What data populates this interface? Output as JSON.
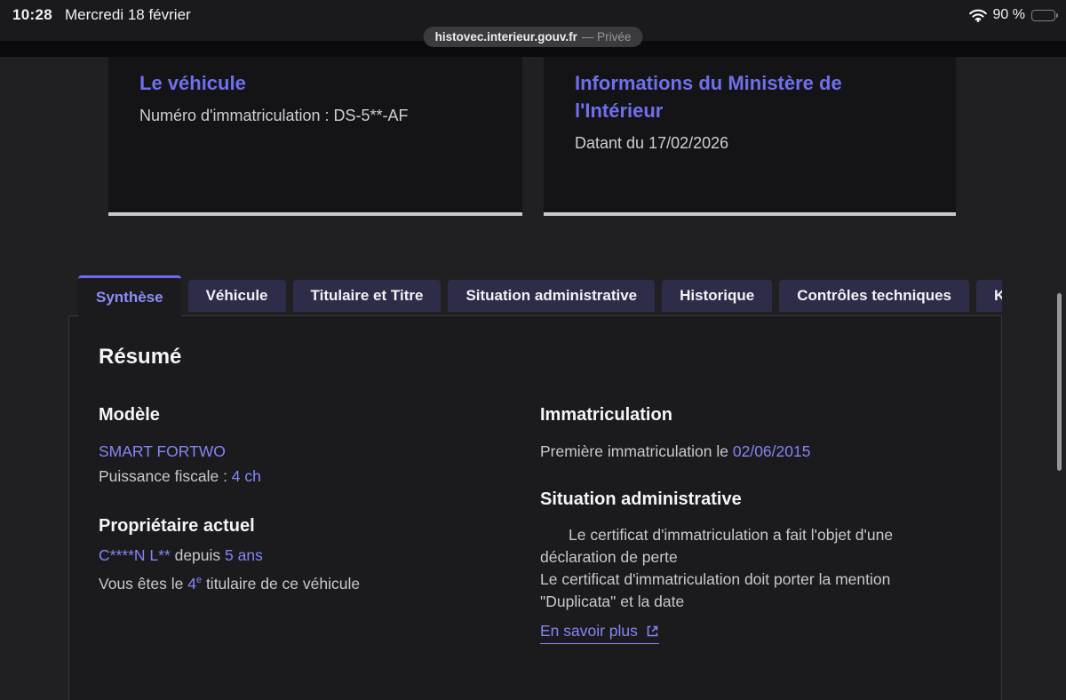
{
  "theme": {
    "accent_title": "#6f6ff0",
    "accent_text": "#8585f6",
    "tab_inactive_bg": "#2d2d49",
    "panel_bg": "#1b1b1d",
    "card_bg": "#141416"
  },
  "status_bar": {
    "time": "10:28",
    "date": "Mercredi 18 février",
    "battery": "90 %",
    "icons": {
      "wifi": "wifi-icon",
      "battery": "battery-icon"
    }
  },
  "browser": {
    "url": "histovec.interieur.gouv.fr",
    "privacy": "— Privée"
  },
  "cards": [
    {
      "title": "Le véhicule",
      "body": "Numéro d'immatriculation : DS-5**-AF"
    },
    {
      "title": "Informations du Ministère de l'Intérieur",
      "body": "Datant du 17/02/2026"
    }
  ],
  "tabs": [
    {
      "label": "Synthèse",
      "active": true
    },
    {
      "label": "Véhicule",
      "active": false
    },
    {
      "label": "Titulaire et Titre",
      "active": false
    },
    {
      "label": "Situation administrative",
      "active": false
    },
    {
      "label": "Historique",
      "active": false
    },
    {
      "label": "Contrôles techniques",
      "active": false
    },
    {
      "label": "Kil",
      "active": false
    }
  ],
  "summary": {
    "title": "Résumé",
    "model": {
      "heading": "Modèle",
      "name": "SMART FORTWO",
      "power_label": "Puissance fiscale : ",
      "power_value": "4 ch"
    },
    "owner": {
      "heading": "Propriétaire actuel",
      "name": "C****N L**",
      "since_label": " depuis ",
      "since_value": "5 ans",
      "holder_prefix": "Vous êtes le ",
      "holder_number": "4",
      "holder_sup": "e",
      "holder_suffix": " titulaire de ce véhicule"
    },
    "registration": {
      "heading": "Immatriculation",
      "first_label": "Première immatriculation le ",
      "first_date": "02/06/2015"
    },
    "admin": {
      "heading": "Situation administrative",
      "line1": "Le certificat d'immatriculation a fait l'objet d'une déclaration de perte",
      "line2": "Le certificat d'immatriculation doit porter la mention \"Duplicata\" et la date",
      "link_label": "En savoir plus",
      "link_icon": "external-link-icon"
    }
  }
}
